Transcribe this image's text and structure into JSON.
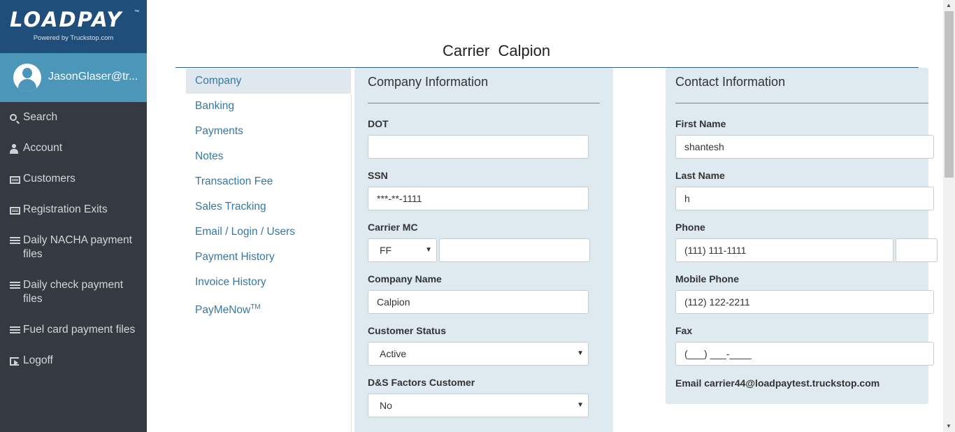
{
  "brand": {
    "name": "LOADPAY",
    "tm": "™",
    "tagline": "Powered by Truckstop.com"
  },
  "user": {
    "name": "JasonGlaser@tr..."
  },
  "sidebar": {
    "items": [
      {
        "label": "Search",
        "icon": "search-icon"
      },
      {
        "label": "Account",
        "icon": "user-icon"
      },
      {
        "label": "Customers",
        "icon": "card-icon"
      },
      {
        "label": "Registration Exits",
        "icon": "card-icon"
      },
      {
        "label": "Daily NACHA payment files",
        "icon": "list-icon"
      },
      {
        "label": "Daily check payment files",
        "icon": "list-icon"
      },
      {
        "label": "Fuel card payment files",
        "icon": "list-icon"
      },
      {
        "label": "Logoff",
        "icon": "logoff-icon"
      }
    ]
  },
  "page": {
    "title": "Carrier  Calpion"
  },
  "tabs": [
    {
      "label": "Company",
      "active": true
    },
    {
      "label": "Banking"
    },
    {
      "label": "Payments"
    },
    {
      "label": "Notes"
    },
    {
      "label": "Transaction Fee"
    },
    {
      "label": "Sales Tracking"
    },
    {
      "label": "Email / Login / Users"
    },
    {
      "label": "Payment History"
    },
    {
      "label": "Invoice History"
    },
    {
      "label": "PayMeNow",
      "sup": "TM"
    }
  ],
  "company": {
    "title": "Company Information",
    "dot_label": "DOT",
    "dot_value": "",
    "ssn_label": "SSN",
    "ssn_value": "***-**-1111",
    "mc_label": "Carrier MC",
    "mc_prefix": "FF",
    "mc_value": "",
    "name_label": "Company Name",
    "name_value": "Calpion",
    "status_label": "Customer Status",
    "status_value": "Active",
    "ds_label": "D&S Factors Customer",
    "ds_value": "No"
  },
  "contact": {
    "title": "Contact Information",
    "first_label": "First Name",
    "first_value": "shantesh",
    "last_label": "Last Name",
    "last_value": "h",
    "phone_label": "Phone",
    "phone_value": "(111) 111-1111",
    "mobile_label": "Mobile Phone",
    "mobile_value": "(112) 122-2211",
    "fax_label": "Fax",
    "fax_value": "(___) ___-____",
    "email_line": "Email carrier44@loadpaytest.truckstop.com"
  },
  "colors": {
    "sidebar": "#353a40",
    "brand": "#1f4e7a",
    "user_bar": "#4c97b9",
    "link": "#3579a4",
    "panel": "#deeaf0"
  }
}
